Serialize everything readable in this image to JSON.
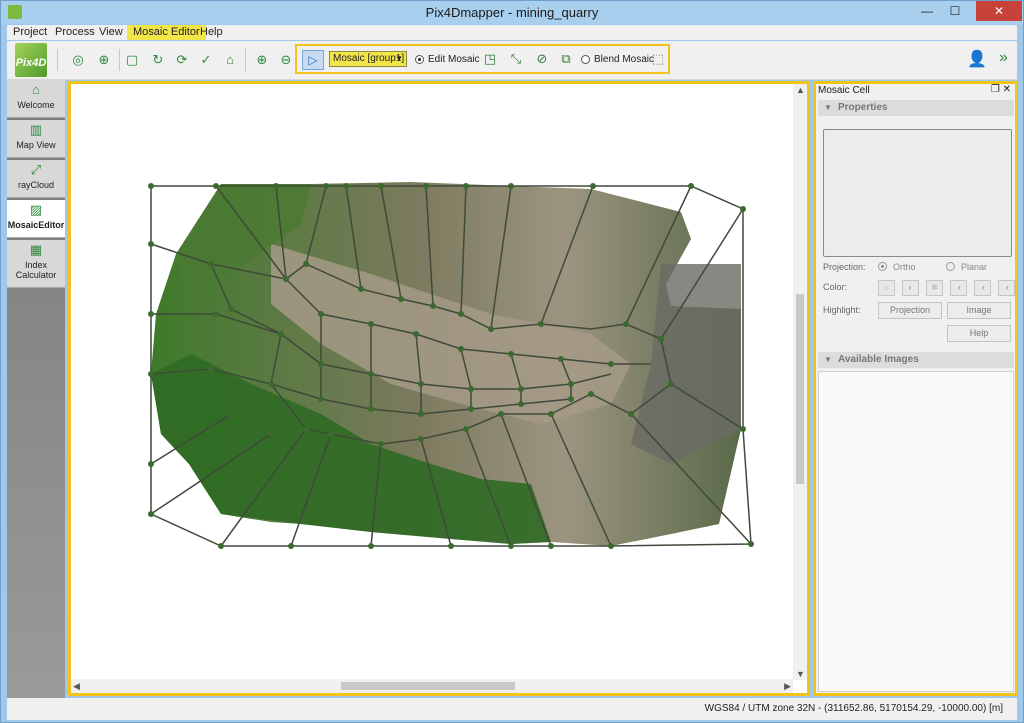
{
  "window": {
    "title": "Pix4Dmapper - mining_quarry",
    "minimize": "—",
    "maximize": "☐",
    "close": "✕"
  },
  "menu": [
    {
      "label": "Project"
    },
    {
      "label": "Process"
    },
    {
      "label": "View"
    },
    {
      "label": "Mosaic Editor",
      "active": true
    },
    {
      "label": "Help"
    }
  ],
  "toolbar": {
    "logo": "Pix4D",
    "mosaic_select": "Mosaic [group1]",
    "edit_mosaic": "Edit Mosaic",
    "blend_mosaic": "Blend Mosaic",
    "edit_mosaic_checked": true,
    "icons": [
      "orbit-icon",
      "target-icon",
      "new-icon",
      "refresh-icon",
      "sync-icon",
      "check-icon",
      "export-icon",
      "zoom-in-icon",
      "zoom-out-icon"
    ]
  },
  "nav": [
    {
      "label": "Welcome",
      "icon": "home-icon"
    },
    {
      "label": "Map View",
      "icon": "map-icon"
    },
    {
      "label": "rayCloud",
      "icon": "raycloud-icon"
    },
    {
      "label": "MosaicEditor",
      "icon": "mosaic-editor-icon",
      "selected": true
    },
    {
      "label": "Index Calculator",
      "icon": "index-calculator-icon"
    }
  ],
  "panel": {
    "title": "Mosaic Cell",
    "properties": "Properties",
    "projection_label": "Projection:",
    "projection_ortho": "Ortho",
    "projection_planar": "Planar",
    "color_label": "Color:",
    "highlight_label": "Highlight:",
    "projection_button": "Projection",
    "image_button": "Image",
    "help_button": "Help",
    "available_images": "Available Images"
  },
  "status": {
    "coords": "WGS84 / UTM zone 32N - (311652.86, 5170154.29, -10000.00) [m]"
  },
  "colors": {
    "accent_highlight": "#f2c41a",
    "menu_active": "#f2e54a",
    "mesh_lines": "#3f4a3a",
    "mesh_nodes": "#3c6a2e"
  }
}
